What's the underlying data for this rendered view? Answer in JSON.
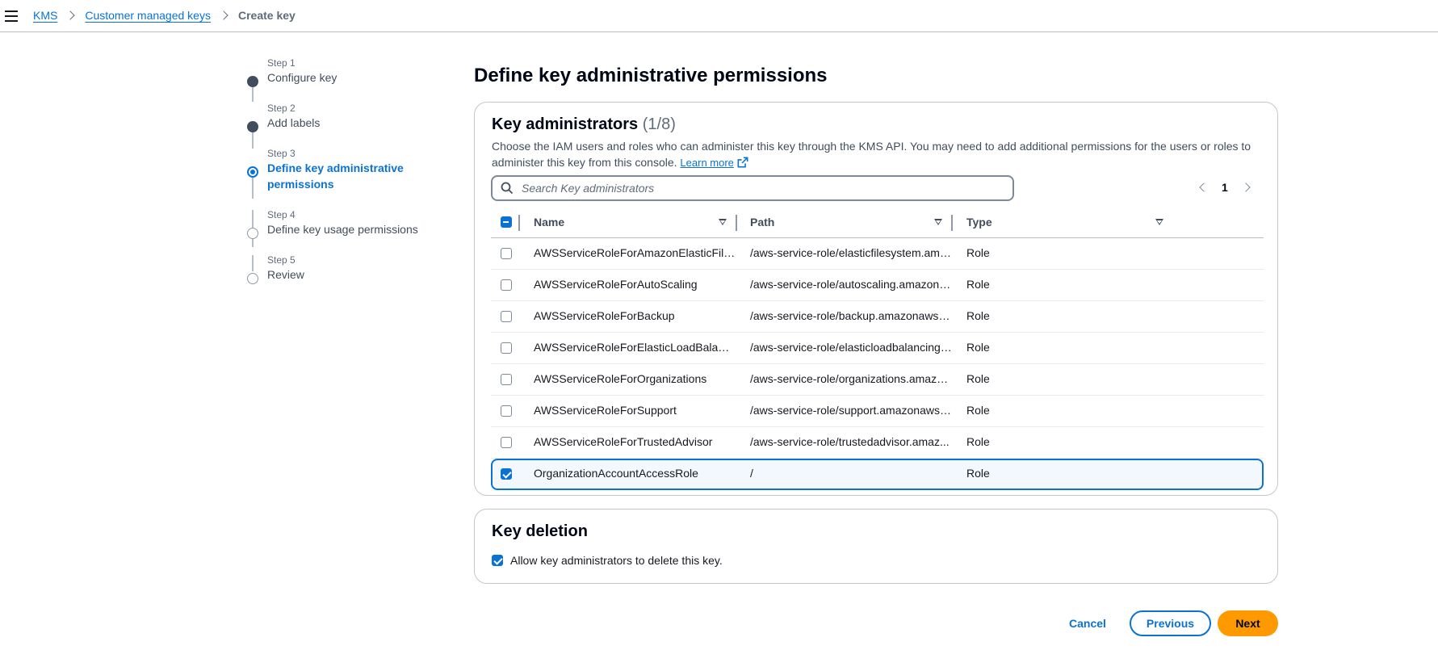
{
  "breadcrumb": {
    "items": [
      "KMS",
      "Customer managed keys"
    ],
    "current": "Create key"
  },
  "steps": [
    {
      "num": "Step 1",
      "label": "Configure key",
      "state": "done"
    },
    {
      "num": "Step 2",
      "label": "Add labels",
      "state": "done"
    },
    {
      "num": "Step 3",
      "label": "Define key administrative permissions",
      "state": "active"
    },
    {
      "num": "Step 4",
      "label": "Define key usage permissions",
      "state": "todo"
    },
    {
      "num": "Step 5",
      "label": "Review",
      "state": "todo"
    }
  ],
  "page_title": "Define key administrative permissions",
  "admins": {
    "title": "Key administrators",
    "count": "(1/8)",
    "description": "Choose the IAM users and roles who can administer this key through the KMS API. You may need to add additional permissions for the users or roles to administer this key from this console.",
    "learn_more": "Learn more",
    "search_placeholder": "Search Key administrators",
    "page": "1",
    "columns": [
      "Name",
      "Path",
      "Type"
    ],
    "rows": [
      {
        "name": "AWSServiceRoleForAmazonElasticFileS...",
        "path": "/aws-service-role/elasticfilesystem.ama...",
        "type": "Role",
        "checked": false
      },
      {
        "name": "AWSServiceRoleForAutoScaling",
        "path": "/aws-service-role/autoscaling.amazona...",
        "type": "Role",
        "checked": false
      },
      {
        "name": "AWSServiceRoleForBackup",
        "path": "/aws-service-role/backup.amazonaws.c...",
        "type": "Role",
        "checked": false
      },
      {
        "name": "AWSServiceRoleForElasticLoadBalancing",
        "path": "/aws-service-role/elasticloadbalancing....",
        "type": "Role",
        "checked": false
      },
      {
        "name": "AWSServiceRoleForOrganizations",
        "path": "/aws-service-role/organizations.amazo...",
        "type": "Role",
        "checked": false
      },
      {
        "name": "AWSServiceRoleForSupport",
        "path": "/aws-service-role/support.amazonaws....",
        "type": "Role",
        "checked": false
      },
      {
        "name": "AWSServiceRoleForTrustedAdvisor",
        "path": "/aws-service-role/trustedadvisor.amaz...",
        "type": "Role",
        "checked": false
      },
      {
        "name": "OrganizationAccountAccessRole",
        "path": "/",
        "type": "Role",
        "checked": true
      }
    ]
  },
  "deletion": {
    "title": "Key deletion",
    "label": "Allow key administrators to delete this key.",
    "checked": true
  },
  "footer": {
    "cancel": "Cancel",
    "previous": "Previous",
    "next": "Next"
  },
  "colors": {
    "link": "#0972d3",
    "primary_button": "#ff9900",
    "text": "#16191f"
  }
}
